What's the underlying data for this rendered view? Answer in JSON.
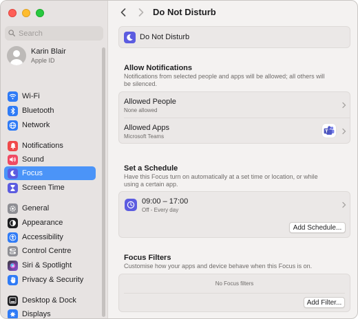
{
  "window": {
    "title": "Do Not Disturb"
  },
  "search": {
    "placeholder": "Search"
  },
  "profile": {
    "name": "Karin Blair",
    "subtitle": "Apple ID"
  },
  "sidebar": {
    "items": [
      {
        "label": "Wi-Fi",
        "icon": "wifi-icon",
        "color": "#2f7bf6"
      },
      {
        "label": "Bluetooth",
        "icon": "bluetooth-icon",
        "color": "#2f7bf6"
      },
      {
        "label": "Network",
        "icon": "globe-icon",
        "color": "#2f7bf6"
      },
      {
        "label": "Notifications",
        "icon": "bell-icon",
        "color": "#f04a4a"
      },
      {
        "label": "Sound",
        "icon": "speaker-icon",
        "color": "#f04a63"
      },
      {
        "label": "Focus",
        "icon": "moon-icon",
        "color": "#5c5ce0",
        "active": true
      },
      {
        "label": "Screen Time",
        "icon": "hourglass-icon",
        "color": "#5c5ce0"
      },
      {
        "label": "General",
        "icon": "gear-icon",
        "color": "#8e8e93"
      },
      {
        "label": "Appearance",
        "icon": "appearance-icon",
        "color": "#1d1d1f"
      },
      {
        "label": "Accessibility",
        "icon": "accessibility-icon",
        "color": "#2f7bf6"
      },
      {
        "label": "Control Centre",
        "icon": "control-centre-icon",
        "color": "#8e8e93"
      },
      {
        "label": "Siri & Spotlight",
        "icon": "siri-icon",
        "color": "#8b4fd8"
      },
      {
        "label": "Privacy & Security",
        "icon": "hand-icon",
        "color": "#2f7bf6"
      },
      {
        "label": "Desktop & Dock",
        "icon": "dock-icon",
        "color": "#1d1d1f"
      },
      {
        "label": "Displays",
        "icon": "display-icon",
        "color": "#2f7bf6"
      }
    ]
  },
  "header": {
    "title": "Do Not Disturb"
  },
  "focus_card": {
    "label": "Do Not Disturb",
    "icon": "moon-icon"
  },
  "allow": {
    "title": "Allow Notifications",
    "description": "Notifications from selected people and apps will be allowed; all others will be silenced.",
    "people": {
      "title": "Allowed People",
      "subtitle": "None allowed"
    },
    "apps": {
      "title": "Allowed Apps",
      "subtitle": "Microsoft Teams",
      "icon": "teams-icon"
    }
  },
  "schedule": {
    "title": "Set a Schedule",
    "description": "Have this Focus turn on automatically at a set time or location, or while using a certain app.",
    "item": {
      "time": "09:00 – 17:00",
      "subtitle": "Off - Every day",
      "icon": "clock-icon"
    },
    "add_button": "Add Schedule..."
  },
  "filters": {
    "title": "Focus Filters",
    "description": "Customise how your apps and device behave when this Focus is on.",
    "empty": "No Focus filters",
    "add_button": "Add Filter..."
  },
  "colors": {
    "accent": "#4b94f8",
    "focus_purple": "#5c5ce0"
  }
}
